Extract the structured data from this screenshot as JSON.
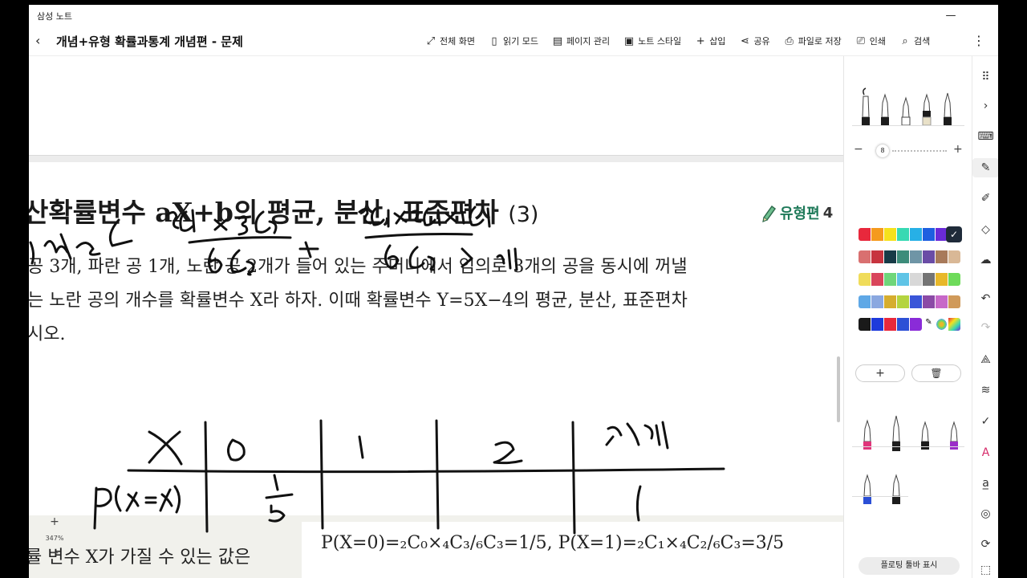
{
  "window": {
    "app_title": "삼성 노트",
    "minimize": "—",
    "maximize": "❐",
    "close": "✕"
  },
  "toolbar": {
    "back": "‹",
    "title": "개념+유형 확률과통계 개념편 - 문제",
    "actions": [
      {
        "icon": "expand-icon",
        "glyph": "⤢",
        "label": "전체 화면"
      },
      {
        "icon": "book-icon",
        "glyph": "▯",
        "label": "읽기 모드"
      },
      {
        "icon": "page-icon",
        "glyph": "▤",
        "label": "페이지 관리"
      },
      {
        "icon": "style-icon",
        "glyph": "▣",
        "label": "노트 스타일"
      },
      {
        "icon": "plus-icon",
        "glyph": "+",
        "label": "삽입"
      },
      {
        "icon": "share-icon",
        "glyph": "⋖",
        "label": "공유"
      },
      {
        "icon": "export-icon",
        "glyph": "⎙",
        "label": "파일로 저장"
      },
      {
        "icon": "print-icon",
        "glyph": "⎚",
        "label": "인쇄"
      },
      {
        "icon": "search-icon",
        "glyph": "⌕",
        "label": "검색"
      }
    ],
    "more": "⋮"
  },
  "note": {
    "heading_main": "산확률변수 aX+b의 평균, 분산, 표준편차",
    "heading_num": "(3)",
    "type_label": "유형편",
    "type_num": "4",
    "problem_lines": [
      "공 3개, 파란 공 1개, 노란 공 2개가 들어 있는 주머니에서 임의로 3개의 공을 동시에 꺼낼",
      "는 노란 공의 개수를 확률변수 X라 하자. 이때 확률변수 Y=5X−4의 평균, 분산, 표준편차",
      "시오."
    ],
    "lower_left": "률 변수 X가 가질 수 있는 값은",
    "formula": "P(X=0)=₂C₀×₄C₃/₆C₃=1/5, P(X=1)=₂C₁×₄C₂/₆C₃=3/5"
  },
  "zoom": {
    "plus": "+",
    "level": "347%",
    "minus": "−"
  },
  "pen_panel": {
    "size_minus": "−",
    "size_value": "8",
    "size_plus": "+",
    "add_button": "+",
    "delete_icon": "🗑",
    "floating_toolbar_label": "플로팅 툴바 표시",
    "palette_rows": [
      [
        "#e8283c",
        "#f59a1d",
        "#f5e11d",
        "#37d9b3",
        "#27b0e6",
        "#1e5fe0",
        "#6a2bd8"
      ],
      [
        "#d97070",
        "#c7343f",
        "#173b47",
        "#3c8c7a",
        "#6f95a6",
        "#6a4ca6",
        "#a87a5a",
        "#d9b896"
      ],
      [
        "#f0dc5a",
        "#d9465a",
        "#6fd67a",
        "#5fc4e6",
        "#d8d8d8",
        "#747474",
        "#e8b82a",
        "#6edb5a"
      ],
      [
        "#5fa8e6",
        "#8aa8e0",
        "#d6ad2e",
        "#b4d440",
        "#3a56d8",
        "#8b4aa6",
        "#c768c8",
        "#d09a5a"
      ],
      [
        "#1a1a1a",
        "#1e3adb",
        "#e8283c",
        "#2d50d6",
        "#8a2bd8"
      ]
    ]
  },
  "side_strip": {
    "icons": [
      "⠿",
      "›",
      "⌨",
      "✎",
      "✐",
      "◇",
      "☁",
      "↶",
      "↷",
      "⟁",
      "≋",
      "✓",
      "A",
      "a̲",
      "◎",
      "⟳",
      "⬚"
    ]
  }
}
